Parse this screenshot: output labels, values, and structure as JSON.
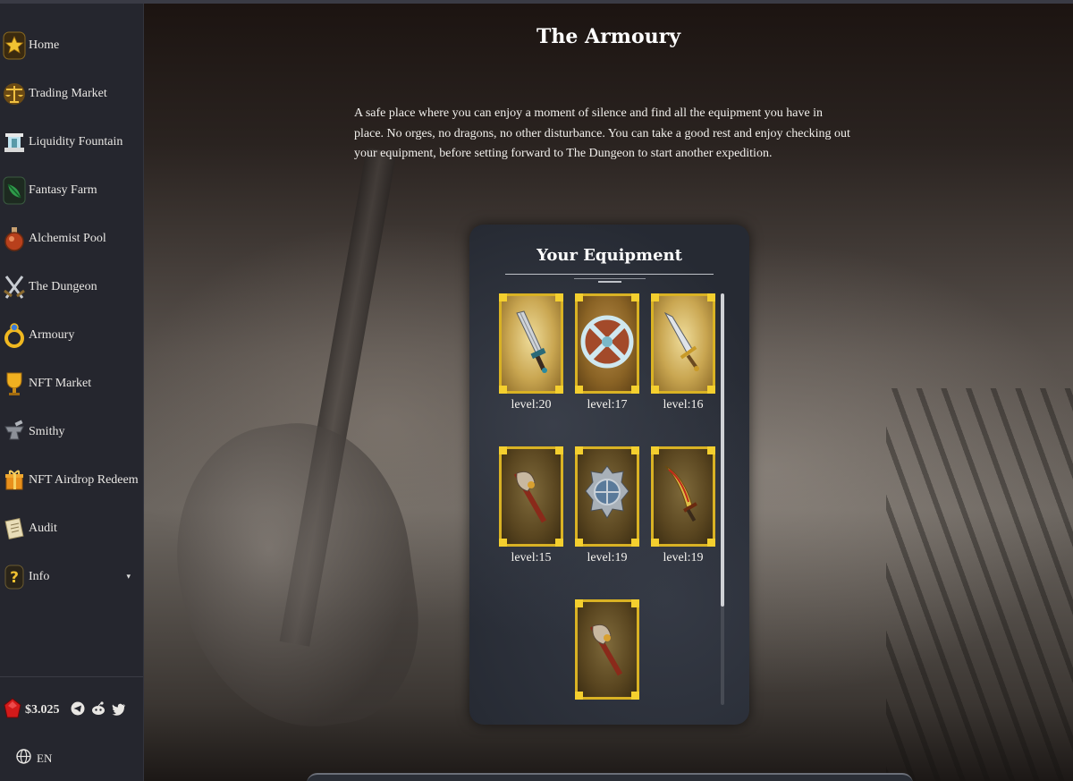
{
  "sidebar": {
    "items": [
      {
        "label": "Home",
        "icon": "star-icon"
      },
      {
        "label": "Trading Market",
        "icon": "scales-icon"
      },
      {
        "label": "Liquidity Fountain",
        "icon": "fountain-icon"
      },
      {
        "label": "Fantasy Farm",
        "icon": "leaf-icon"
      },
      {
        "label": "Alchemist Pool",
        "icon": "potion-icon"
      },
      {
        "label": "The Dungeon",
        "icon": "crossed-swords-icon"
      },
      {
        "label": "Armoury",
        "icon": "ring-icon"
      },
      {
        "label": "NFT Market",
        "icon": "trophy-icon"
      },
      {
        "label": "Smithy",
        "icon": "anvil-icon"
      },
      {
        "label": "NFT Airdrop Redeem",
        "icon": "gift-icon"
      },
      {
        "label": "Audit",
        "icon": "scroll-icon"
      },
      {
        "label": "Info",
        "icon": "question-icon",
        "caret": "▾"
      }
    ],
    "price": "$3.025",
    "language": "EN"
  },
  "main": {
    "title": "The Armoury",
    "intro": "A safe place where you can enjoy a moment of silence and find all the equipment you have in place. No orges, no dragons, no other disturbance. You can take a good rest and enjoy checking out your equipment, before setting forward to The Dungeon to start another expedition."
  },
  "equipment": {
    "title": "Your Equipment",
    "items": [
      {
        "level": "level:20",
        "icon": "dagger-icon"
      },
      {
        "level": "level:17",
        "icon": "shield-icon"
      },
      {
        "level": "level:16",
        "icon": "sword-icon"
      },
      {
        "level": "level:15",
        "icon": "axe-icon"
      },
      {
        "level": "level:19",
        "icon": "spiked-shield-icon"
      },
      {
        "level": "level:19",
        "icon": "scimitar-icon"
      },
      {
        "level": "",
        "icon": "axe-icon"
      }
    ]
  },
  "colors": {
    "sidebar_bg": "#25262e",
    "card_border": "#d9b224",
    "panel_bg": "#262a33"
  }
}
